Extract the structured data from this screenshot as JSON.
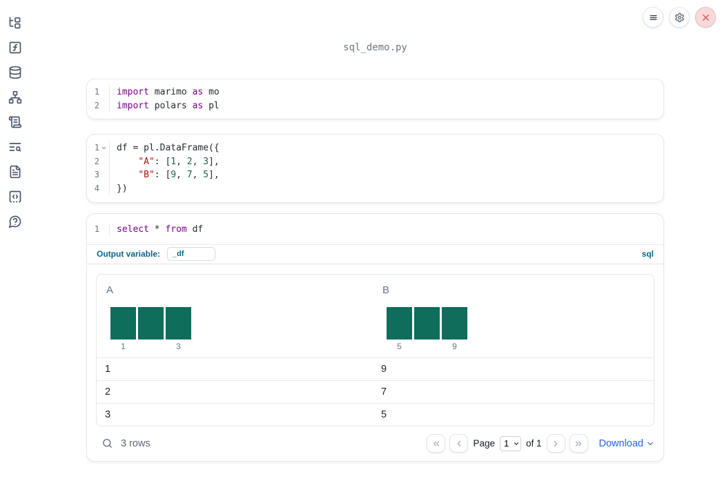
{
  "window": {
    "title": "sql_demo.py"
  },
  "topbar": {
    "buttons": [
      {
        "name": "menu",
        "icon": "hamburger-icon"
      },
      {
        "name": "settings",
        "icon": "gear-icon"
      },
      {
        "name": "close",
        "icon": "x-icon"
      }
    ]
  },
  "sidebar": {
    "items": [
      {
        "name": "file-explorer",
        "icon": "file-tree-icon"
      },
      {
        "name": "variables",
        "icon": "function-square-icon"
      },
      {
        "name": "data-sources",
        "icon": "database-icon"
      },
      {
        "name": "dependency-graph",
        "icon": "network-icon"
      },
      {
        "name": "logs",
        "icon": "scroll-text-icon"
      },
      {
        "name": "documentation-search",
        "icon": "text-search-icon"
      },
      {
        "name": "scratchpad",
        "icon": "file-text-icon"
      },
      {
        "name": "snippets",
        "icon": "code-square-icon"
      },
      {
        "name": "help",
        "icon": "help-bubble-icon"
      }
    ]
  },
  "colors": {
    "accent_teal_blue": "#0c6488",
    "link_blue": "#2563eb",
    "histogram_bar": "#0e6d5b",
    "close_button_bg": "#f8d9d9",
    "close_button_fg": "#c4565c",
    "code_keyword": "#770088",
    "code_string": "#aa1111",
    "code_number": "#116644"
  },
  "cells": [
    {
      "name": "imports-cell",
      "lines": [
        {
          "num": "1",
          "tokens": [
            [
              "import",
              "kw"
            ],
            [
              " marimo ",
              "pl"
            ],
            [
              "as",
              "kw"
            ],
            [
              " mo",
              "pl"
            ]
          ]
        },
        {
          "num": "2",
          "tokens": [
            [
              "import",
              "kw"
            ],
            [
              " polars ",
              "pl"
            ],
            [
              "as",
              "kw"
            ],
            [
              " pl",
              "pl"
            ]
          ]
        }
      ]
    },
    {
      "name": "dataframe-cell",
      "lines": [
        {
          "num": "1",
          "fold": true,
          "tokens": [
            [
              "df = pl.DataFrame({",
              "pl"
            ]
          ]
        },
        {
          "num": "2",
          "tokens": [
            [
              "    ",
              "pl"
            ],
            [
              "\"A\"",
              "str"
            ],
            [
              ": [",
              "pl"
            ],
            [
              "1",
              "num"
            ],
            [
              ", ",
              "pl"
            ],
            [
              "2",
              "num"
            ],
            [
              ", ",
              "pl"
            ],
            [
              "3",
              "num"
            ],
            [
              "],",
              "pl"
            ]
          ]
        },
        {
          "num": "3",
          "tokens": [
            [
              "    ",
              "pl"
            ],
            [
              "\"B\"",
              "str"
            ],
            [
              ": [",
              "pl"
            ],
            [
              "9",
              "num"
            ],
            [
              ", ",
              "pl"
            ],
            [
              "7",
              "num"
            ],
            [
              ", ",
              "pl"
            ],
            [
              "5",
              "num"
            ],
            [
              "],",
              "pl"
            ]
          ]
        },
        {
          "num": "4",
          "tokens": [
            [
              "})",
              "pl"
            ]
          ]
        }
      ]
    },
    {
      "name": "sql-cell",
      "lines": [
        {
          "num": "1",
          "tokens": [
            [
              "select",
              "kw"
            ],
            [
              " * ",
              "pl"
            ],
            [
              "from",
              "kw"
            ],
            [
              " df",
              "pl"
            ]
          ]
        }
      ],
      "output_variable": {
        "label": "Output variable:",
        "value": "_df"
      },
      "language_badge": "sql"
    }
  ],
  "table": {
    "columns": [
      "A",
      "B"
    ],
    "rows": [
      [
        "1",
        "9"
      ],
      [
        "2",
        "7"
      ],
      [
        "3",
        "5"
      ]
    ],
    "footer": {
      "row_count": "3 rows",
      "page_label": "Page",
      "page_value": "1",
      "of_label": "of 1",
      "download_label": "Download"
    }
  },
  "chart_data": [
    {
      "type": "histogram",
      "column": "A",
      "x": [
        1,
        2,
        3
      ],
      "counts": [
        1,
        1,
        1
      ],
      "axis_labels": [
        "1",
        "3"
      ]
    },
    {
      "type": "histogram",
      "column": "B",
      "x": [
        5,
        7,
        9
      ],
      "counts": [
        1,
        1,
        1
      ],
      "axis_labels": [
        "5",
        "9"
      ]
    }
  ]
}
